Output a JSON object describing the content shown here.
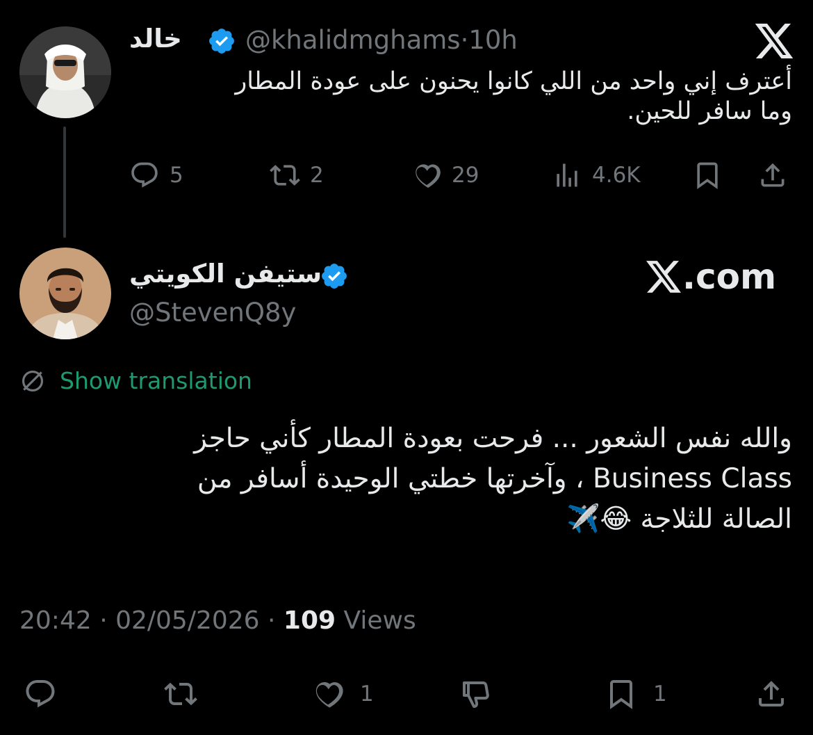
{
  "parent_tweet": {
    "display_name": "خالد",
    "handle": "@khalidmghams",
    "separator": "·",
    "time": "10h",
    "text_line1": "أعترف إني واحد من اللي كانوا يحنون على عودة المطار",
    "text_line2": "وما سافر للحين.",
    "actions": {
      "replies": "5",
      "retweets": "2",
      "likes": "29",
      "views": "4.6K"
    },
    "icons": [
      "x-logo-icon",
      "verified-badge-icon",
      "reply-icon",
      "retweet-icon",
      "like-icon",
      "views-icon",
      "bookmark-icon",
      "share-icon"
    ]
  },
  "reply_tweet": {
    "display_name": "ستيفن الكويتي",
    "handle": "@StevenQ8y",
    "watermark": ".com",
    "show_translation": "Show translation",
    "text_line1": "والله نفس الشعور ...  فرحت بعودة المطار كأني حاجز",
    "text_line2": "Business Class ، وآخرتها خطتي الوحيدة أسافر من",
    "text_line3": "الصالة للثلاجة 😂✈️",
    "timestamp": "20:42 · 02/05/2026",
    "meta_sep": " · ",
    "views_count": "109",
    "views_label": " Views",
    "actions": {
      "likes": "1",
      "bookmarks": "1"
    },
    "icons": [
      "globe-icon",
      "verified-badge-icon",
      "reply-icon",
      "retweet-icon",
      "like-icon",
      "dislike-icon",
      "bookmark-icon",
      "share-icon"
    ]
  },
  "colors": {
    "background": "#000000",
    "text": "#e7e9ea",
    "secondary": "#71767b",
    "verified": "#1d9bf0",
    "translate": "#1d9b6f",
    "thread_line": "#333639"
  }
}
